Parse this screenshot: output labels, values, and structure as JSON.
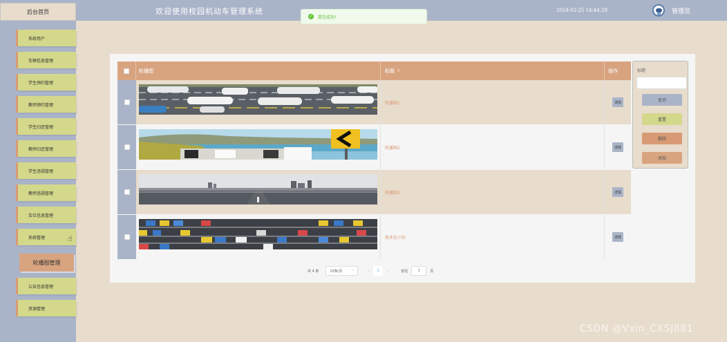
{
  "header": {
    "home_tab": "后台首页",
    "app_title": "欢迎使用校园机动车管理系统",
    "toast": "提交成功！",
    "datetime": "2024-02-25 14:44:28",
    "user_role": "管理员"
  },
  "sidebar": {
    "items": [
      {
        "label": "系统用户"
      },
      {
        "label": "车辆信息管理"
      },
      {
        "label": "学生预约管理"
      },
      {
        "label": "教师预约管理"
      },
      {
        "label": "学生归还管理"
      },
      {
        "label": "教师归还管理"
      },
      {
        "label": "学生违规管理"
      },
      {
        "label": "教师违规管理"
      },
      {
        "label": "车位信息管理"
      },
      {
        "label": "系统管理"
      },
      {
        "label": "轮播图管理",
        "active": true
      },
      {
        "label": "公告信息管理"
      },
      {
        "label": "资源管理"
      }
    ]
  },
  "table": {
    "headers": {
      "image": "轮播图",
      "title": "标题",
      "action": "操作"
    },
    "rows": [
      {
        "title": "轮播图1",
        "action": "详情"
      },
      {
        "title": "轮播图2",
        "action": "详情"
      },
      {
        "title": "轮播图3",
        "action": "详情"
      },
      {
        "title": "熟多负少的",
        "action": "详情"
      }
    ]
  },
  "search": {
    "label": "标题",
    "input_value": "",
    "query": "查询",
    "reset": "重置",
    "delete": "删除",
    "add": "添加"
  },
  "pagination": {
    "total": "共 4 条",
    "page_size": "10条/页",
    "prev": "‹",
    "current": "1",
    "next": "›",
    "goto_prefix": "前往",
    "goto_value": "1",
    "goto_suffix": "页"
  },
  "watermark": "CSDN @Vxin_CXSJ881",
  "colors": {
    "sidebar_bg": "#aab4c8",
    "menu_item": "#d4d88a",
    "accent": "#d8a480",
    "page_bg": "#e8dccc"
  }
}
